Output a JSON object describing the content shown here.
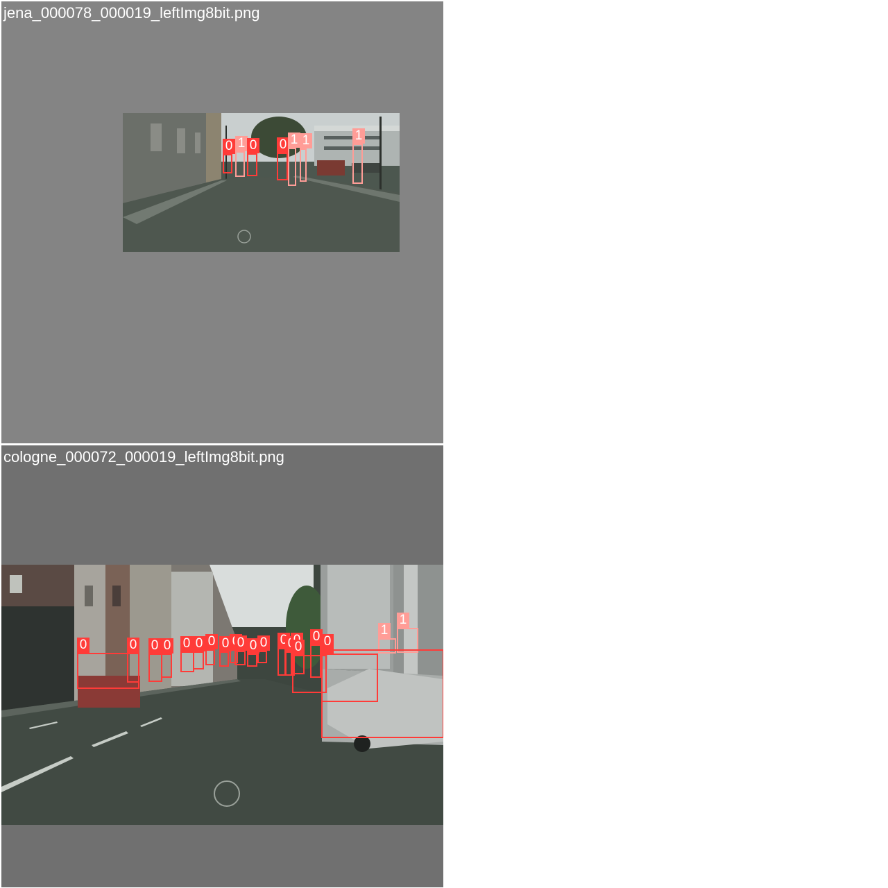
{
  "colors": {
    "class_0": "#ff3b38",
    "class_1": "#ff9d97",
    "background": "#ffffff",
    "letterbox_top": "#848484",
    "letterbox_bottom": "#707070"
  },
  "images": [
    {
      "filename": "jena_000078_000019_leftImg8bit.png",
      "detections": [
        {
          "class": "0"
        },
        {
          "class": "1"
        },
        {
          "class": "0"
        },
        {
          "class": "0"
        },
        {
          "class": "1"
        },
        {
          "class": "1"
        },
        {
          "class": "1"
        }
      ]
    },
    {
      "filename": "cologne_000072_000019_leftImg8bit.png",
      "detections": [
        {
          "class": "0"
        },
        {
          "class": "0"
        },
        {
          "class": "0"
        },
        {
          "class": "0"
        },
        {
          "class": "0"
        },
        {
          "class": "0"
        },
        {
          "class": "0"
        },
        {
          "class": "0"
        },
        {
          "class": "0"
        },
        {
          "class": "0"
        },
        {
          "class": "0"
        },
        {
          "class": "0"
        },
        {
          "class": "0"
        },
        {
          "class": "0"
        },
        {
          "class": "0"
        },
        {
          "class": "0"
        },
        {
          "class": "0"
        },
        {
          "class": "1"
        },
        {
          "class": "1"
        },
        {
          "class": "0"
        },
        {
          "class": "0"
        }
      ]
    }
  ]
}
